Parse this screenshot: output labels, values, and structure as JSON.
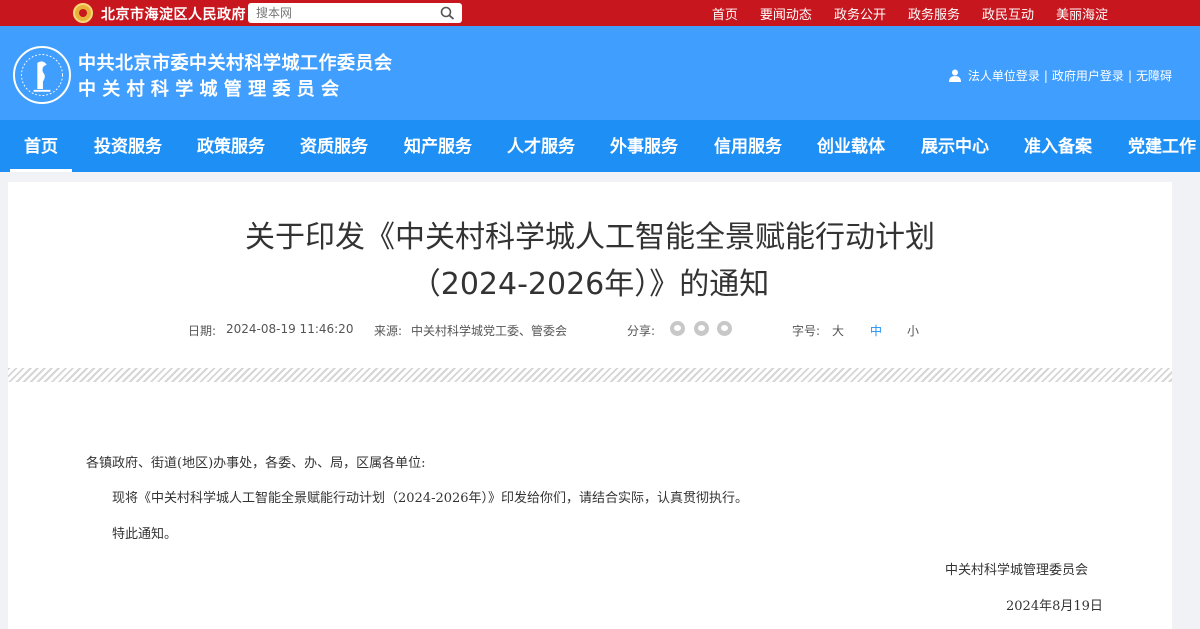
{
  "topbar": {
    "gov_name": "北京市海淀区人民政府",
    "search_placeholder": "搜本网",
    "links": [
      "首页",
      "要闻动态",
      "政务公开",
      "政务服务",
      "政民互动",
      "美丽海淀"
    ]
  },
  "header": {
    "title_line1": "中共北京市委中关村科学城工作委员会",
    "title_line2": "中关村科学城管理委员会",
    "login_legal": "法人单位登录",
    "login_gov": "政府用户登录",
    "accessibility": "无障碍",
    "separator": "|"
  },
  "nav": {
    "items": [
      "首页",
      "投资服务",
      "政策服务",
      "资质服务",
      "知产服务",
      "人才服务",
      "外事服务",
      "信用服务",
      "创业载体",
      "展示中心",
      "准入备案",
      "党建工作"
    ]
  },
  "article": {
    "title_line1": "关于印发《中关村科学城人工智能全景赋能行动计划",
    "title_line2": "（2024-2026年）》的通知",
    "date_label": "日期:",
    "date": "2024-08-19 11:46:20",
    "source_label": "来源:",
    "source": "中关村科学城党工委、管委会",
    "share_label": "分享:",
    "font_label": "字号:",
    "font_sizes": [
      "大",
      "中",
      "小"
    ],
    "salutation": "各镇政府、街道(地区)办事处，各委、办、局，区属各单位:",
    "paragraph1": "现将《中关村科学城人工智能全景赋能行动计划（2024-2026年）》印发给你们，请结合实际，认真贯彻执行。",
    "paragraph2": "特此通知。",
    "signature": "中关村科学城管理委员会",
    "sign_date": "2024年8月19日"
  },
  "colors": {
    "top_red": "#c8161e",
    "header_blue": "#409eff",
    "nav_blue": "#1d8ff5"
  },
  "icons": [
    "national-emblem-icon",
    "search-icon",
    "logo-emblem-icon",
    "user-icon",
    "wechat-icon",
    "weibo-icon",
    "favorite-icon"
  ]
}
